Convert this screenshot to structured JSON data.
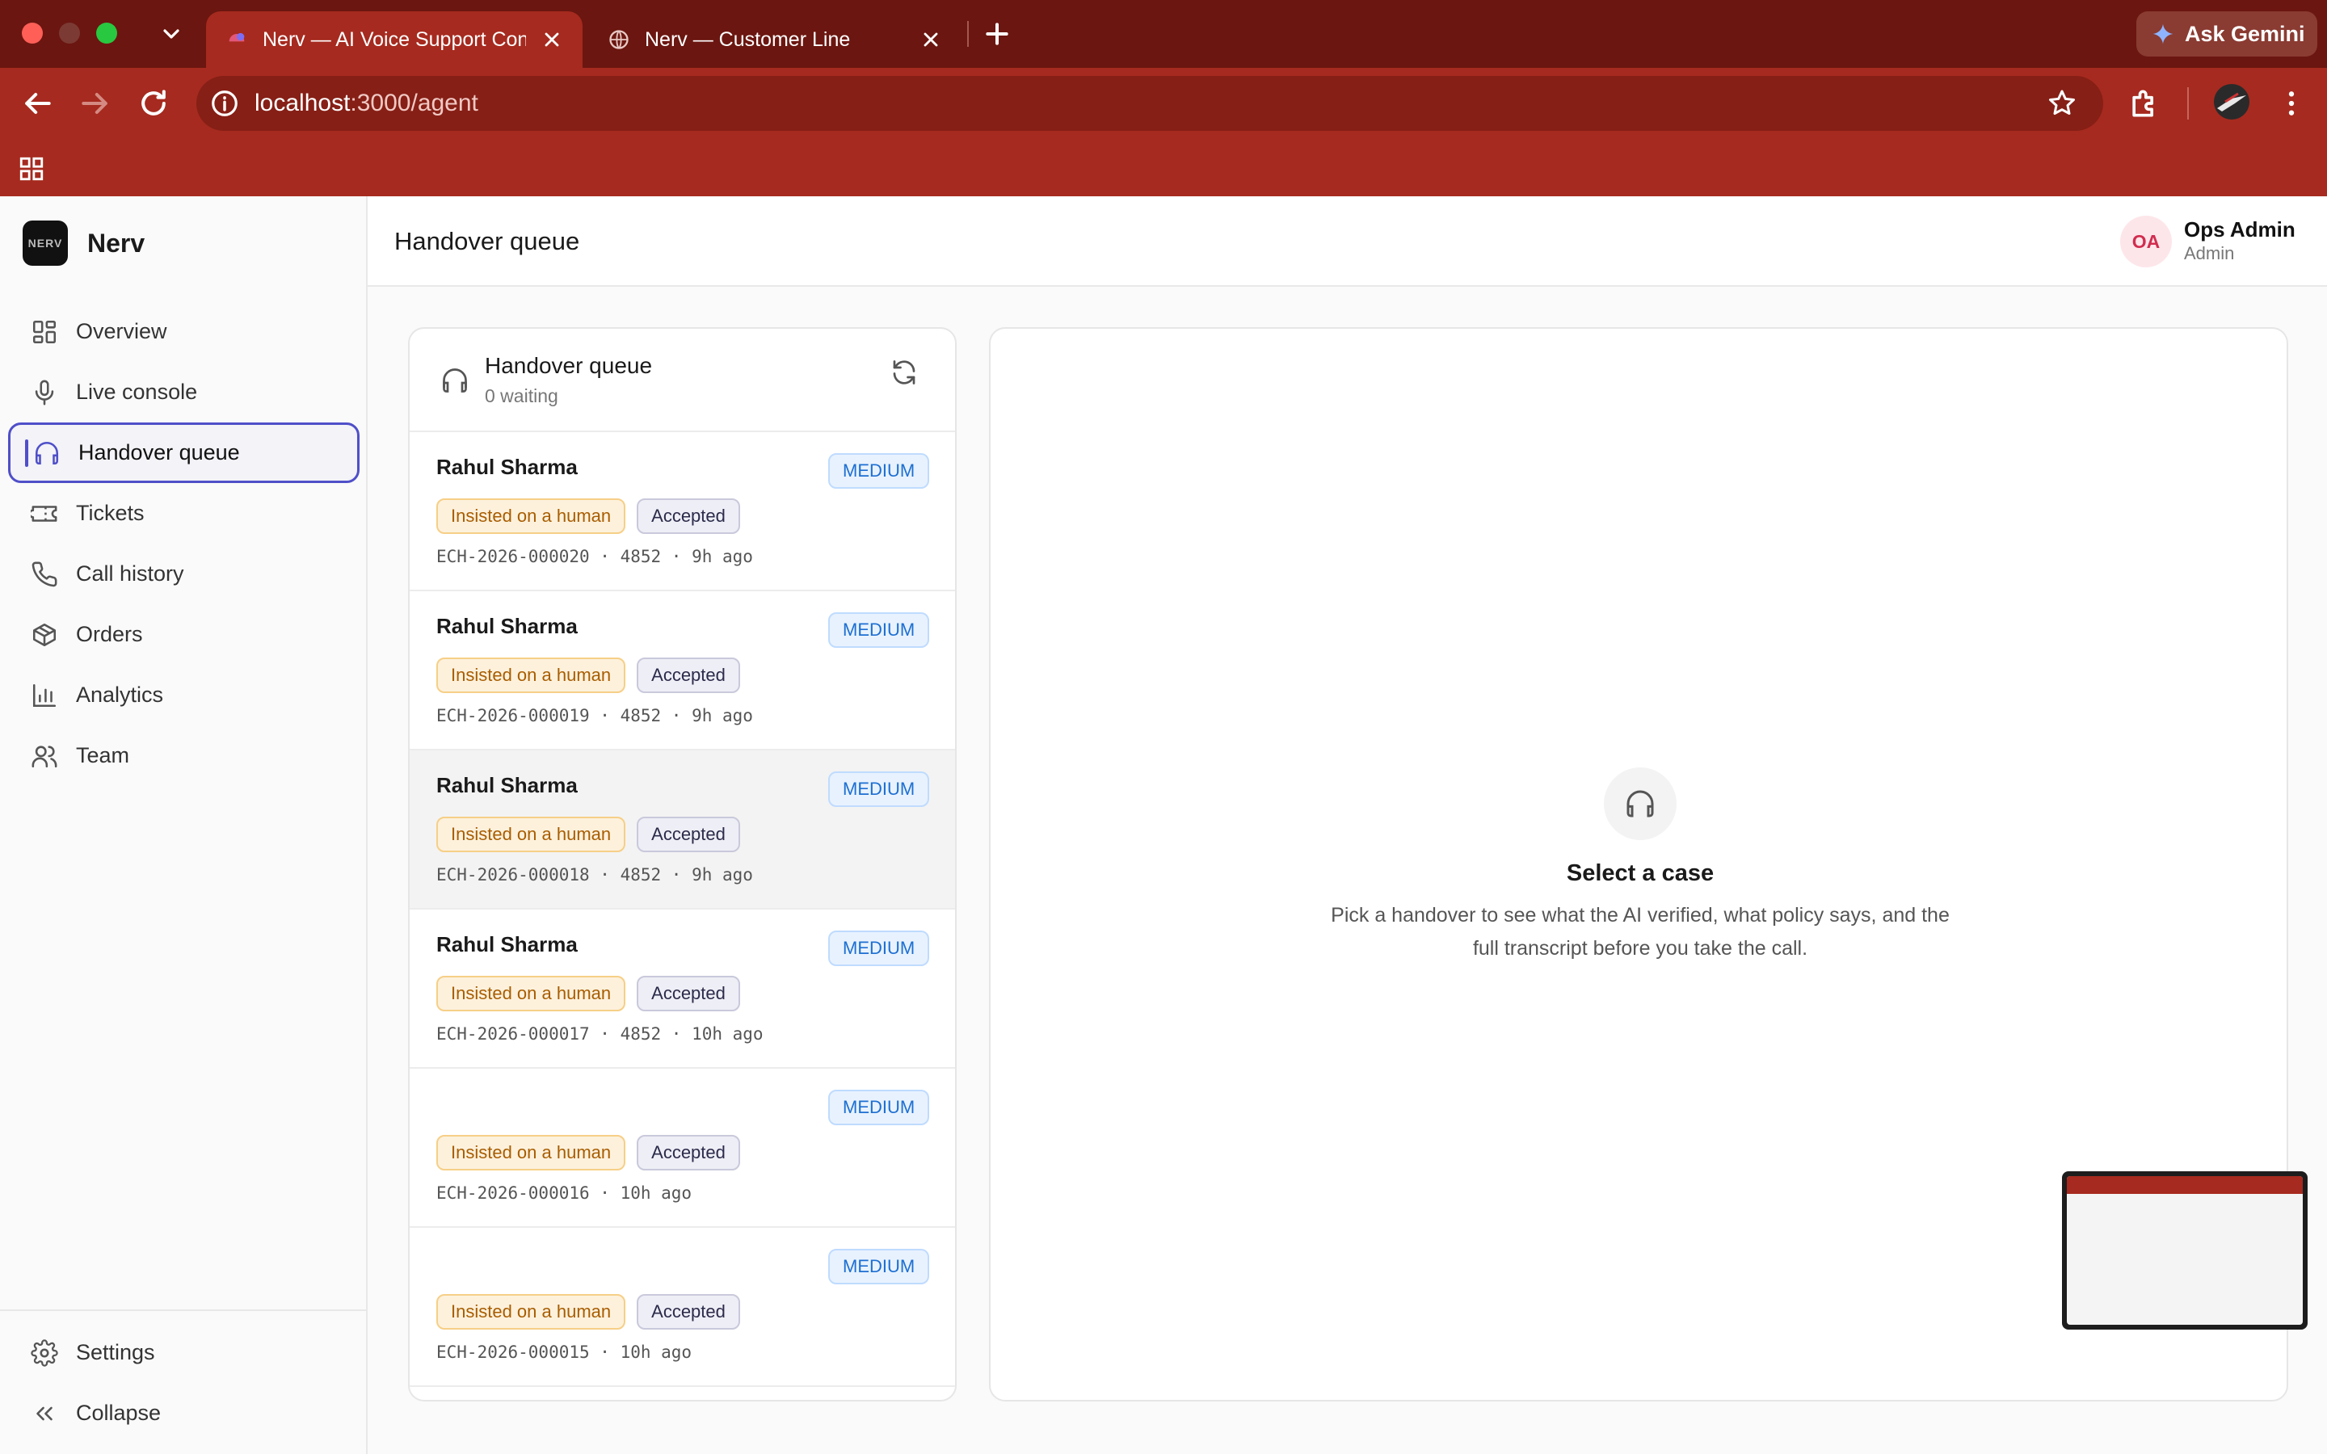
{
  "browser": {
    "tabs": [
      {
        "title": "Nerv — AI Voice Support Con",
        "active": true
      },
      {
        "title": "Nerv — Customer Line",
        "active": false
      }
    ],
    "url_host": "localhost",
    "url_path": ":3000/agent",
    "gemini_label": "Ask Gemini",
    "accent_color": "#a62a1f"
  },
  "brand": {
    "logo_text": "NERV",
    "name": "Nerv"
  },
  "sidebar": {
    "items": [
      {
        "label": "Overview",
        "icon": "grid-icon"
      },
      {
        "label": "Live console",
        "icon": "mic-icon"
      },
      {
        "label": "Handover queue",
        "icon": "headphones-icon",
        "active": true
      },
      {
        "label": "Tickets",
        "icon": "ticket-icon"
      },
      {
        "label": "Call history",
        "icon": "phone-icon"
      },
      {
        "label": "Orders",
        "icon": "package-icon"
      },
      {
        "label": "Analytics",
        "icon": "bar-chart-icon"
      },
      {
        "label": "Team",
        "icon": "users-icon"
      }
    ],
    "bottom": [
      {
        "label": "Settings",
        "icon": "gear-icon"
      },
      {
        "label": "Collapse",
        "icon": "chevrons-left-icon"
      }
    ]
  },
  "header": {
    "title": "Handover queue",
    "user": {
      "initials": "OA",
      "name": "Ops Admin",
      "role": "Admin"
    }
  },
  "queue": {
    "title": "Handover queue",
    "subtitle": "0 waiting",
    "rows": [
      {
        "name": "Rahul Sharma",
        "priority": "MEDIUM",
        "reason": "Insisted on a human",
        "status": "Accepted",
        "meta": "ECH-2026-000020 · 4852 · 9h ago"
      },
      {
        "name": "Rahul Sharma",
        "priority": "MEDIUM",
        "reason": "Insisted on a human",
        "status": "Accepted",
        "meta": "ECH-2026-000019 · 4852 · 9h ago"
      },
      {
        "name": "Rahul Sharma",
        "priority": "MEDIUM",
        "reason": "Insisted on a human",
        "status": "Accepted",
        "meta": "ECH-2026-000018 · 4852 · 9h ago",
        "selected": true
      },
      {
        "name": "Rahul Sharma",
        "priority": "MEDIUM",
        "reason": "Insisted on a human",
        "status": "Accepted",
        "meta": "ECH-2026-000017 · 4852 · 10h ago"
      },
      {
        "name": "",
        "priority": "MEDIUM",
        "reason": "Insisted on a human",
        "status": "Accepted",
        "meta": "ECH-2026-000016 · 10h ago"
      },
      {
        "name": "",
        "priority": "MEDIUM",
        "reason": "Insisted on a human",
        "status": "Accepted",
        "meta": "ECH-2026-000015 · 10h ago"
      }
    ]
  },
  "detail": {
    "empty_title": "Select a case",
    "empty_description": "Pick a handover to see what the AI verified, what policy says, and the full transcript before you take the call."
  }
}
